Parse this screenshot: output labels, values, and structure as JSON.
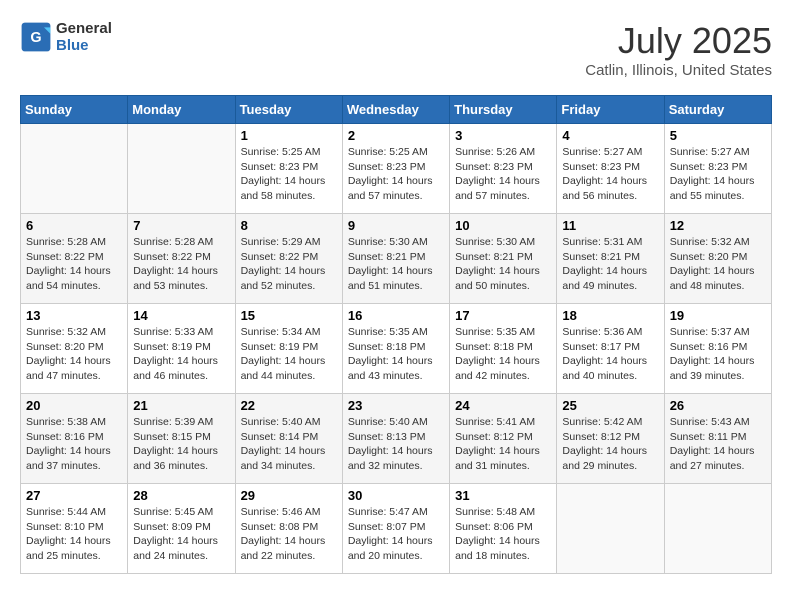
{
  "header": {
    "logo_line1": "General",
    "logo_line2": "Blue",
    "month": "July 2025",
    "location": "Catlin, Illinois, United States"
  },
  "weekdays": [
    "Sunday",
    "Monday",
    "Tuesday",
    "Wednesday",
    "Thursday",
    "Friday",
    "Saturday"
  ],
  "weeks": [
    [
      {
        "day": "",
        "info": ""
      },
      {
        "day": "",
        "info": ""
      },
      {
        "day": "1",
        "info": "Sunrise: 5:25 AM\nSunset: 8:23 PM\nDaylight: 14 hours and 58 minutes."
      },
      {
        "day": "2",
        "info": "Sunrise: 5:25 AM\nSunset: 8:23 PM\nDaylight: 14 hours and 57 minutes."
      },
      {
        "day": "3",
        "info": "Sunrise: 5:26 AM\nSunset: 8:23 PM\nDaylight: 14 hours and 57 minutes."
      },
      {
        "day": "4",
        "info": "Sunrise: 5:27 AM\nSunset: 8:23 PM\nDaylight: 14 hours and 56 minutes."
      },
      {
        "day": "5",
        "info": "Sunrise: 5:27 AM\nSunset: 8:23 PM\nDaylight: 14 hours and 55 minutes."
      }
    ],
    [
      {
        "day": "6",
        "info": "Sunrise: 5:28 AM\nSunset: 8:22 PM\nDaylight: 14 hours and 54 minutes."
      },
      {
        "day": "7",
        "info": "Sunrise: 5:28 AM\nSunset: 8:22 PM\nDaylight: 14 hours and 53 minutes."
      },
      {
        "day": "8",
        "info": "Sunrise: 5:29 AM\nSunset: 8:22 PM\nDaylight: 14 hours and 52 minutes."
      },
      {
        "day": "9",
        "info": "Sunrise: 5:30 AM\nSunset: 8:21 PM\nDaylight: 14 hours and 51 minutes."
      },
      {
        "day": "10",
        "info": "Sunrise: 5:30 AM\nSunset: 8:21 PM\nDaylight: 14 hours and 50 minutes."
      },
      {
        "day": "11",
        "info": "Sunrise: 5:31 AM\nSunset: 8:21 PM\nDaylight: 14 hours and 49 minutes."
      },
      {
        "day": "12",
        "info": "Sunrise: 5:32 AM\nSunset: 8:20 PM\nDaylight: 14 hours and 48 minutes."
      }
    ],
    [
      {
        "day": "13",
        "info": "Sunrise: 5:32 AM\nSunset: 8:20 PM\nDaylight: 14 hours and 47 minutes."
      },
      {
        "day": "14",
        "info": "Sunrise: 5:33 AM\nSunset: 8:19 PM\nDaylight: 14 hours and 46 minutes."
      },
      {
        "day": "15",
        "info": "Sunrise: 5:34 AM\nSunset: 8:19 PM\nDaylight: 14 hours and 44 minutes."
      },
      {
        "day": "16",
        "info": "Sunrise: 5:35 AM\nSunset: 8:18 PM\nDaylight: 14 hours and 43 minutes."
      },
      {
        "day": "17",
        "info": "Sunrise: 5:35 AM\nSunset: 8:18 PM\nDaylight: 14 hours and 42 minutes."
      },
      {
        "day": "18",
        "info": "Sunrise: 5:36 AM\nSunset: 8:17 PM\nDaylight: 14 hours and 40 minutes."
      },
      {
        "day": "19",
        "info": "Sunrise: 5:37 AM\nSunset: 8:16 PM\nDaylight: 14 hours and 39 minutes."
      }
    ],
    [
      {
        "day": "20",
        "info": "Sunrise: 5:38 AM\nSunset: 8:16 PM\nDaylight: 14 hours and 37 minutes."
      },
      {
        "day": "21",
        "info": "Sunrise: 5:39 AM\nSunset: 8:15 PM\nDaylight: 14 hours and 36 minutes."
      },
      {
        "day": "22",
        "info": "Sunrise: 5:40 AM\nSunset: 8:14 PM\nDaylight: 14 hours and 34 minutes."
      },
      {
        "day": "23",
        "info": "Sunrise: 5:40 AM\nSunset: 8:13 PM\nDaylight: 14 hours and 32 minutes."
      },
      {
        "day": "24",
        "info": "Sunrise: 5:41 AM\nSunset: 8:12 PM\nDaylight: 14 hours and 31 minutes."
      },
      {
        "day": "25",
        "info": "Sunrise: 5:42 AM\nSunset: 8:12 PM\nDaylight: 14 hours and 29 minutes."
      },
      {
        "day": "26",
        "info": "Sunrise: 5:43 AM\nSunset: 8:11 PM\nDaylight: 14 hours and 27 minutes."
      }
    ],
    [
      {
        "day": "27",
        "info": "Sunrise: 5:44 AM\nSunset: 8:10 PM\nDaylight: 14 hours and 25 minutes."
      },
      {
        "day": "28",
        "info": "Sunrise: 5:45 AM\nSunset: 8:09 PM\nDaylight: 14 hours and 24 minutes."
      },
      {
        "day": "29",
        "info": "Sunrise: 5:46 AM\nSunset: 8:08 PM\nDaylight: 14 hours and 22 minutes."
      },
      {
        "day": "30",
        "info": "Sunrise: 5:47 AM\nSunset: 8:07 PM\nDaylight: 14 hours and 20 minutes."
      },
      {
        "day": "31",
        "info": "Sunrise: 5:48 AM\nSunset: 8:06 PM\nDaylight: 14 hours and 18 minutes."
      },
      {
        "day": "",
        "info": ""
      },
      {
        "day": "",
        "info": ""
      }
    ]
  ]
}
